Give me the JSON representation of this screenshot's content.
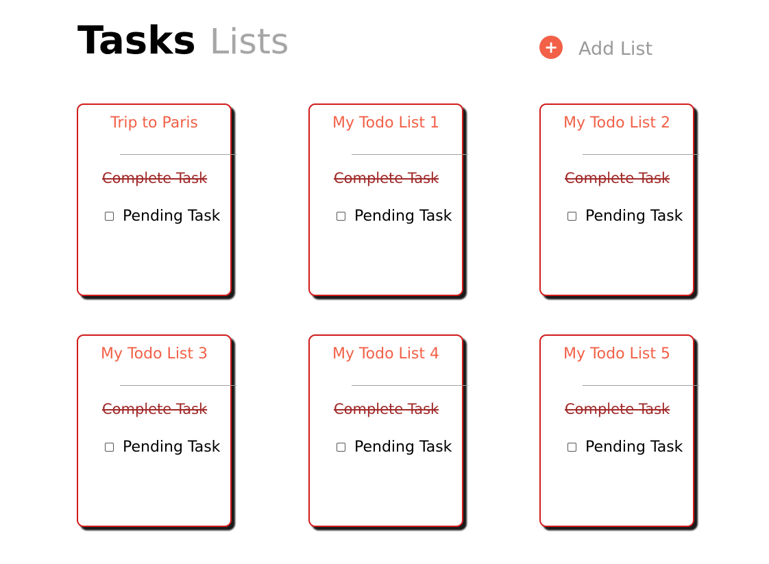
{
  "header": {
    "title": "Tasks",
    "subtitle": "Lists",
    "add_list_icon": "+",
    "add_list_label": "Add List"
  },
  "lists": [
    {
      "title": "Trip to Paris",
      "complete_task": "Complete Task",
      "pending_task": "Pending Task"
    },
    {
      "title": "My Todo List 1",
      "complete_task": "Complete Task",
      "pending_task": "Pending Task"
    },
    {
      "title": "My Todo List 2",
      "complete_task": "Complete Task",
      "pending_task": "Pending Task"
    },
    {
      "title": "My Todo List 3",
      "complete_task": "Complete Task",
      "pending_task": "Pending Task"
    },
    {
      "title": "My Todo List 4",
      "complete_task": "Complete Task",
      "pending_task": "Pending Task"
    },
    {
      "title": "My Todo List 5",
      "complete_task": "Complete Task",
      "pending_task": "Pending Task"
    }
  ],
  "colors": {
    "accent": "#f26047",
    "card_border": "#d11a1a",
    "completed_text": "#a02828",
    "subtitle": "#a6a6a6"
  },
  "icons": {
    "add": "plus-circle-icon",
    "checkbox": "checkbox-icon"
  }
}
